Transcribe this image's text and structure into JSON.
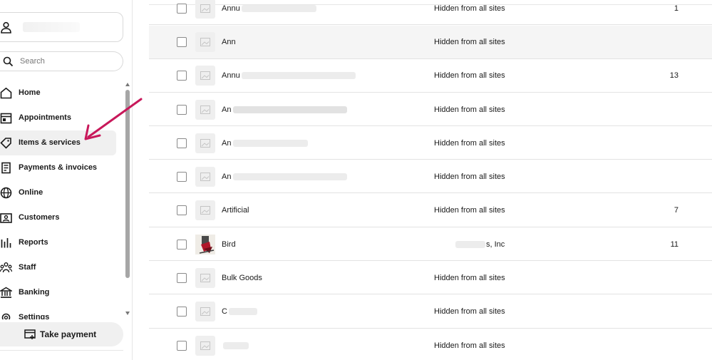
{
  "sidebar": {
    "search": {
      "placeholder": "Search"
    },
    "nav": [
      {
        "label": "Home",
        "icon": "home-icon"
      },
      {
        "label": "Appointments",
        "icon": "calendar-icon"
      },
      {
        "label": "Items & services",
        "icon": "tag-icon"
      },
      {
        "label": "Payments & invoices",
        "icon": "receipt-icon"
      },
      {
        "label": "Online",
        "icon": "globe-icon"
      },
      {
        "label": "Customers",
        "icon": "contact-card-icon"
      },
      {
        "label": "Reports",
        "icon": "bar-chart-icon"
      },
      {
        "label": "Staff",
        "icon": "people-icon"
      },
      {
        "label": "Banking",
        "icon": "bank-icon"
      },
      {
        "label": "Settings",
        "icon": "gear-icon"
      }
    ],
    "take_payment_label": "Take payment"
  },
  "items": [
    {
      "name": "Annu",
      "visibility": "Hidden from all sites",
      "count": "1"
    },
    {
      "name": "Ann",
      "visibility": "Hidden from all sites",
      "count": ""
    },
    {
      "name": "Annu",
      "visibility": "Hidden from all sites",
      "count": "13"
    },
    {
      "name": "An",
      "visibility": "Hidden from all sites",
      "count": ""
    },
    {
      "name": "An",
      "visibility": "Hidden from all sites",
      "count": ""
    },
    {
      "name": "An",
      "visibility": "Hidden from all sites",
      "count": ""
    },
    {
      "name": "Artificial",
      "visibility": "Hidden from all sites",
      "count": "7"
    },
    {
      "name": "Bird",
      "visibility": "s, Inc",
      "count": "11"
    },
    {
      "name": "Bulk Goods",
      "visibility": "Hidden from all sites",
      "count": ""
    },
    {
      "name": "C",
      "visibility": "Hidden from all sites",
      "count": ""
    },
    {
      "name": "",
      "visibility": "Hidden from all sites",
      "count": ""
    }
  ],
  "colors": {
    "annotation_arrow": "#c8185a",
    "active_nav_bg": "#f0f0f0",
    "highlight_row_bg": "#f5f5f5"
  }
}
